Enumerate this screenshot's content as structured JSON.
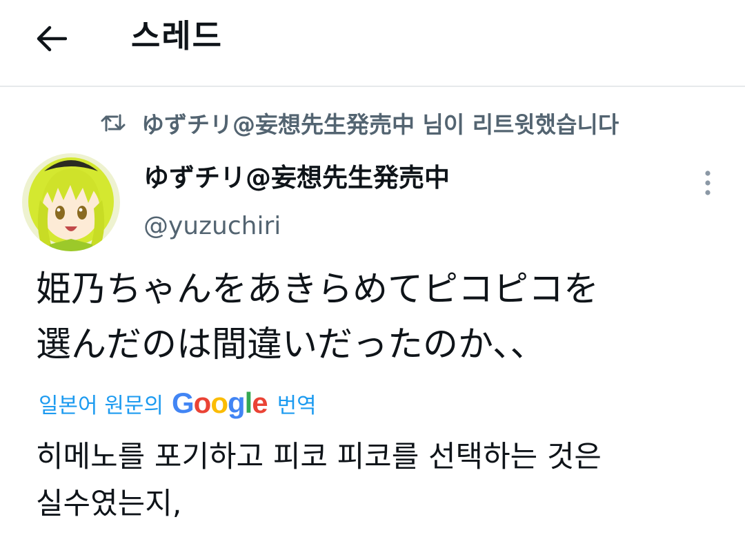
{
  "header": {
    "title": "스레드"
  },
  "retweet": {
    "text": "ゆずチリ@妄想先生発売中 님이 리트윗했습니다"
  },
  "tweet": {
    "display_name": "ゆずチリ@妄想先生発売中",
    "handle": "@yuzuchiri",
    "text_line1": "姫乃ちゃんをあきらめてピコピコを",
    "text_line2": "選んだのは間違いだったのか、、",
    "translate": {
      "lead": "일본어 원문의",
      "logo_letters": [
        "G",
        "o",
        "o",
        "g",
        "l",
        "e"
      ],
      "logo_colors": [
        "#4285f4",
        "#ea4335",
        "#fbbc05",
        "#4285f4",
        "#34a853",
        "#ea4335"
      ],
      "tail": "번역"
    },
    "translated_line1": "히메노를 포기하고 피코 피코를 선택하는 것은",
    "translated_line2": "실수였는지,"
  },
  "icons": {
    "back": "arrow-left-icon",
    "retweet": "retweet-icon",
    "more": "more-vertical-icon"
  },
  "colors": {
    "text_primary": "#0f1419",
    "text_secondary": "#536471",
    "link": "#1d9bf0",
    "divider": "#e6e9eb"
  }
}
